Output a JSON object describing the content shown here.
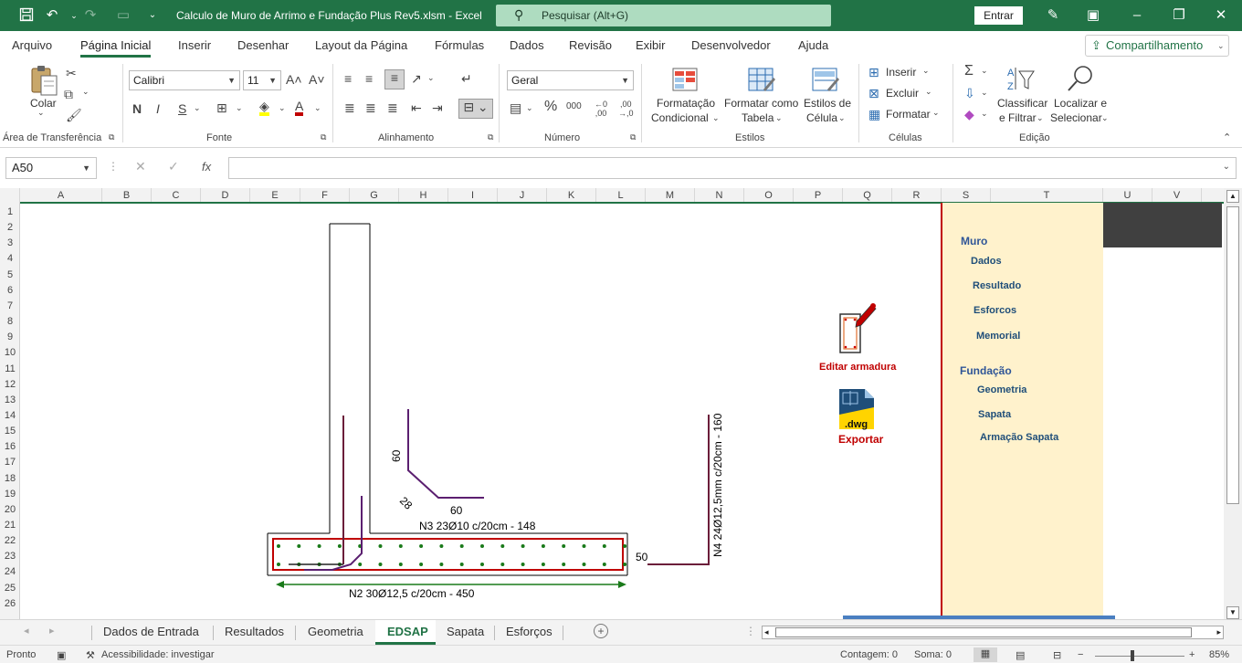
{
  "titlebar": {
    "doc_title": "Calculo de Muro de Arrimo e Fundação Plus Rev5.xlsm  -  Excel",
    "search_placeholder": "Pesquisar (Alt+G)",
    "signin_label": "Entrar",
    "accent": "#217346"
  },
  "menu": {
    "tabs": [
      "Arquivo",
      "Página Inicial",
      "Inserir",
      "Desenhar",
      "Layout da Página",
      "Fórmulas",
      "Dados",
      "Revisão",
      "Exibir",
      "Desenvolvedor",
      "Ajuda"
    ],
    "active": "Página Inicial",
    "share_label": "Compartilhamento"
  },
  "ribbon": {
    "clipboard": {
      "paste_label": "Colar",
      "group_label": "Área de Transferência"
    },
    "font": {
      "font_name": "Calibri",
      "font_size": "11",
      "bold": "N",
      "italic": "I",
      "underline": "S",
      "group_label": "Fonte"
    },
    "alignment": {
      "group_label": "Alinhamento"
    },
    "number": {
      "format": "Geral",
      "group_label": "Número"
    },
    "styles": {
      "conditional_1": "Formatação",
      "conditional_2": "Condicional",
      "table_1": "Formatar como",
      "table_2": "Tabela",
      "cell_1": "Estilos de",
      "cell_2": "Célula",
      "group_label": "Estilos"
    },
    "cells": {
      "insert": "Inserir",
      "delete": "Excluir",
      "format": "Formatar",
      "group_label": "Células"
    },
    "editing": {
      "sort_1": "Classificar",
      "sort_2": "e Filtrar",
      "find_1": "Localizar e",
      "find_2": "Selecionar",
      "group_label": "Edição"
    }
  },
  "formula_bar": {
    "name_box": "A50",
    "fx": "fx",
    "formula": ""
  },
  "grid": {
    "columns": [
      "A",
      "B",
      "C",
      "D",
      "E",
      "F",
      "G",
      "H",
      "I",
      "J",
      "K",
      "L",
      "M",
      "N",
      "O",
      "P",
      "Q",
      "R",
      "S",
      "T",
      "U",
      "V"
    ],
    "rows": [
      "1",
      "2",
      "3",
      "4",
      "5",
      "6",
      "7",
      "8",
      "9",
      "10",
      "11",
      "12",
      "13",
      "14",
      "15",
      "16",
      "17",
      "18",
      "19",
      "20",
      "21",
      "22",
      "23",
      "24",
      "25",
      "26"
    ]
  },
  "drawing": {
    "dim_60_vertical": "60",
    "dim_28": "28",
    "dim_60_horizontal": "60",
    "n3_label": "N3 23Ø10 c/20cm - 148",
    "n2_label": "N2 30Ø12,5 c/20cm - 450",
    "dim_50": "50",
    "n4_label": "N4 24Ø12,5mm c/20cm - 160"
  },
  "tools": {
    "edit_rebar_label": "Editar armadura",
    "export_label": "Exportar",
    "dwg_text": ".dwg"
  },
  "sidebar": {
    "muro_title": "Muro",
    "muro_items": [
      "Dados",
      "Resultado",
      "Esforcos",
      "Memorial"
    ],
    "fundacao_title": "Fundação",
    "fundacao_items": [
      "Geometria",
      "Sapata",
      "Armação Sapata"
    ]
  },
  "sheet_tabs": {
    "tabs": [
      "Dados de Entrada",
      "Resultados",
      "Geometria",
      "EDSAP",
      "Sapata",
      "Esforços"
    ],
    "active": "EDSAP"
  },
  "status": {
    "ready": "Pronto",
    "accessibility": "Acessibilidade: investigar",
    "count": "Contagem: 0",
    "sum": "Soma: 0",
    "zoom": "85%"
  }
}
